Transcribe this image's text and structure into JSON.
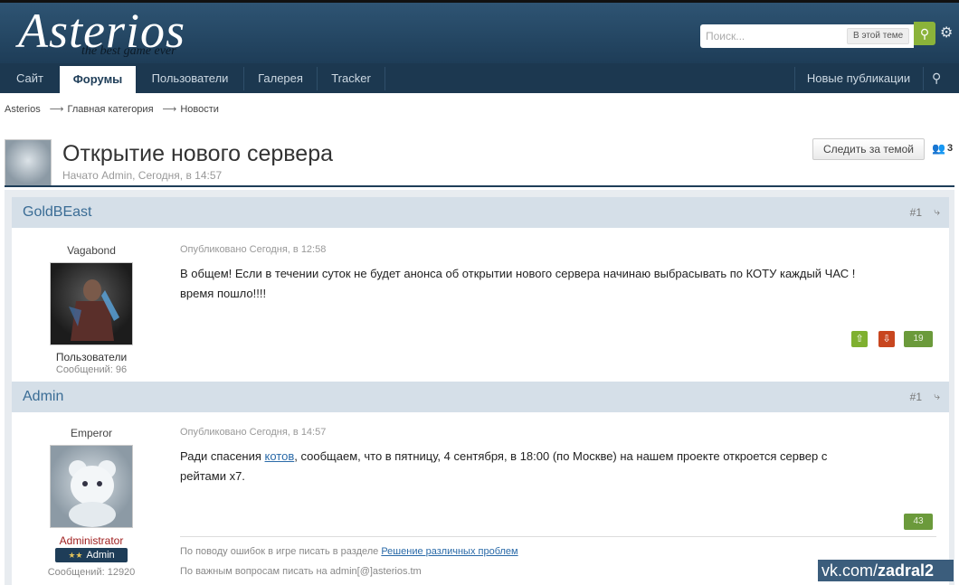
{
  "header": {
    "logo": "Asterios",
    "logo_tagline": "the best game ever",
    "search_placeholder": "Поиск...",
    "search_scope": "В этой теме"
  },
  "nav": {
    "items": [
      "Сайт",
      "Форумы",
      "Пользователи",
      "Галерея",
      "Tracker"
    ],
    "active": "Форумы",
    "right_item": "Новые публикации"
  },
  "breadcrumb": [
    "Asterios",
    "Главная категория",
    "Новости"
  ],
  "topic": {
    "title": "Открытие нового сервера",
    "started": "Начато Admin, Сегодня, в 14:57",
    "follow_label": "Следить за темой",
    "followers": "3"
  },
  "posts": [
    {
      "author": "GoldBEast",
      "number": "#1",
      "rank": "Vagabond",
      "group": "Пользователи",
      "post_count": "Сообщений: 96",
      "date": "Опубликовано Сегодня, в 12:58",
      "text_line1": "В общем! Если в течении суток не будет анонса об открытии нового сервера начинаю выбрасывать по КОТУ каждый ЧАС !",
      "text_line2": "время пошло!!!!",
      "reputation": "19"
    },
    {
      "author": "Admin",
      "number": "#1",
      "rank": "Emperor",
      "group": "Administrator",
      "badge": "Admin",
      "post_count": "Сообщений: 12920",
      "date": "Опубликовано Сегодня, в 14:57",
      "text_before": "Ради спасения ",
      "text_link": "котов",
      "text_after": ", сообщаем, что в пятницу, 4 сентября, в 18:00 (по Москве) на нашем проекте откроется сервер с",
      "text_line2": "рейтами x7.",
      "reputation": "43",
      "signature_line1_text": "По поводу ошибок в игре писать в разделе ",
      "signature_line1_link": "Решение различных проблем",
      "signature_line2": "По важным вопросам писать на admin[@]asterios.tm"
    }
  ],
  "watermark": {
    "prefix": "vk.com/",
    "name": "zadral2"
  }
}
